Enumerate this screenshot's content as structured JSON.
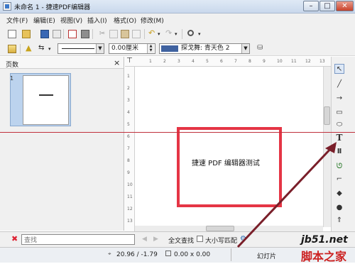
{
  "window": {
    "title": "未命名 1 - 捷速PDF编辑器",
    "minimize": "–",
    "maximize": "□",
    "close": "✕"
  },
  "menu": [
    {
      "label": "文件(F)"
    },
    {
      "label": "编辑(E)"
    },
    {
      "label": "视图(V)"
    },
    {
      "label": "插入(I)"
    },
    {
      "label": "格式(O)"
    },
    {
      "label": "修改(M)"
    }
  ],
  "toolbar2": {
    "line_width": "0.00厘米",
    "color_name": "探戈舞: 青天色 2",
    "color_swatch": "#3f62a0"
  },
  "pages_pane": {
    "title": "页数",
    "close": "×",
    "page_number": "1"
  },
  "ruler_top": [
    "1",
    "2",
    "3",
    "4",
    "5",
    "6",
    "7",
    "8",
    "9",
    "10",
    "11",
    "12",
    "13"
  ],
  "ruler_left": [
    "1",
    "2",
    "3",
    "4",
    "5",
    "6",
    "7",
    "8",
    "9",
    "10",
    "11",
    "12",
    "13"
  ],
  "document": {
    "text": "捷速 PDF 编辑器测试"
  },
  "colors": {
    "highlight_box": "#e53545",
    "guide_line": "#c0303c",
    "arrow": "#7a1f2a"
  },
  "find_bar": {
    "placeholder": "查找",
    "find_all": "全文查找",
    "match_case": "大小写匹配"
  },
  "status_bar": {
    "position": "20.96 / -1.79",
    "size": "0.00 x 0.00",
    "mode": "幻灯片"
  },
  "watermark": {
    "site": "jb51.net",
    "brand": "脚本之家"
  }
}
